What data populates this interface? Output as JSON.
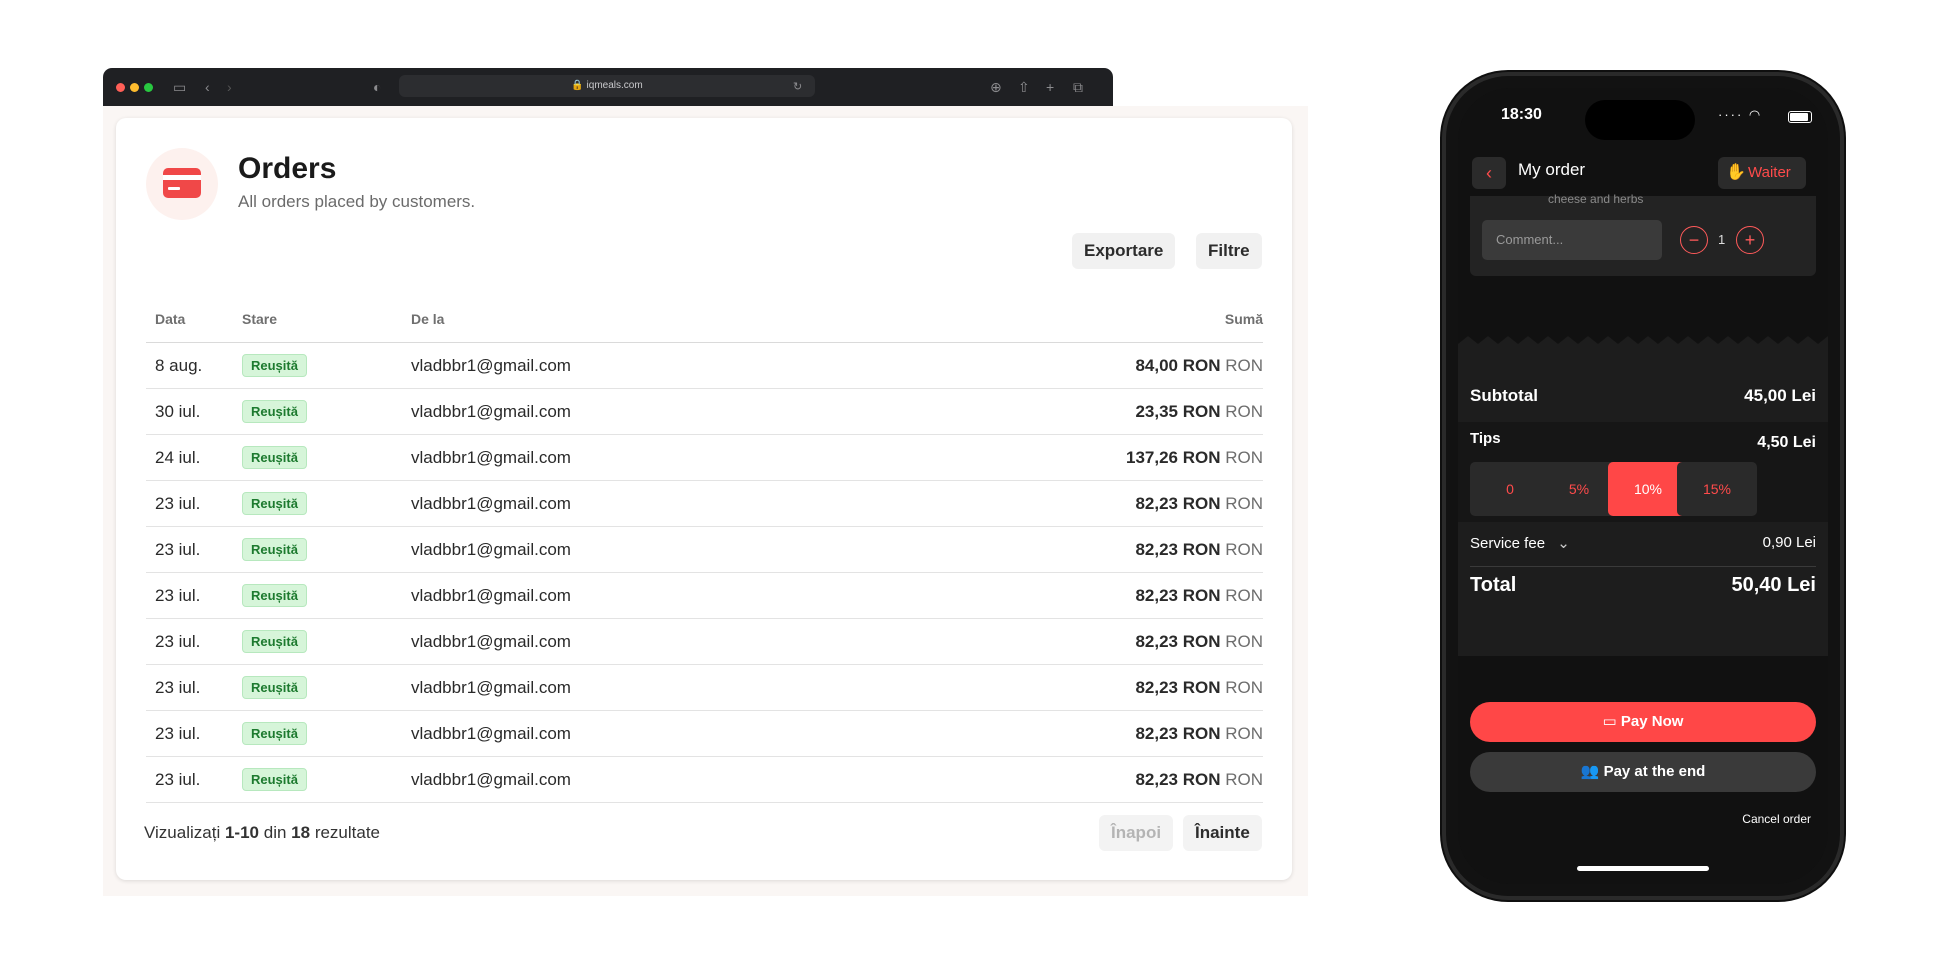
{
  "browser": {
    "url": "iqmeals.com"
  },
  "orders_page": {
    "title": "Orders",
    "subtitle": "All orders placed by customers.",
    "export_label": "Exportare",
    "filter_label": "Filtre",
    "columns": {
      "date": "Data",
      "status": "Stare",
      "from": "De la",
      "amount": "Sumă"
    },
    "rows": [
      {
        "date": "8 aug.",
        "status": "Reușită",
        "email": "vladbbr1@gmail.com",
        "amount": "84,00 RON",
        "currency": "RON"
      },
      {
        "date": "30 iul.",
        "status": "Reușită",
        "email": "vladbbr1@gmail.com",
        "amount": "23,35 RON",
        "currency": "RON"
      },
      {
        "date": "24 iul.",
        "status": "Reușită",
        "email": "vladbbr1@gmail.com",
        "amount": "137,26 RON",
        "currency": "RON"
      },
      {
        "date": "23 iul.",
        "status": "Reușită",
        "email": "vladbbr1@gmail.com",
        "amount": "82,23 RON",
        "currency": "RON"
      },
      {
        "date": "23 iul.",
        "status": "Reușită",
        "email": "vladbbr1@gmail.com",
        "amount": "82,23 RON",
        "currency": "RON"
      },
      {
        "date": "23 iul.",
        "status": "Reușită",
        "email": "vladbbr1@gmail.com",
        "amount": "82,23 RON",
        "currency": "RON"
      },
      {
        "date": "23 iul.",
        "status": "Reușită",
        "email": "vladbbr1@gmail.com",
        "amount": "82,23 RON",
        "currency": "RON"
      },
      {
        "date": "23 iul.",
        "status": "Reușită",
        "email": "vladbbr1@gmail.com",
        "amount": "82,23 RON",
        "currency": "RON"
      },
      {
        "date": "23 iul.",
        "status": "Reușită",
        "email": "vladbbr1@gmail.com",
        "amount": "82,23 RON",
        "currency": "RON"
      },
      {
        "date": "23 iul.",
        "status": "Reușită",
        "email": "vladbbr1@gmail.com",
        "amount": "82,23 RON",
        "currency": "RON"
      }
    ],
    "pagination": {
      "prefix": "Vizualizați",
      "range": "1-10",
      "middle": "din",
      "total": "18",
      "suffix": "rezultate",
      "prev_label": "Înapoi",
      "next_label": "Înainte"
    },
    "colors": {
      "accent": "#f04848",
      "success_bg": "#d6f5d9",
      "success_text": "#1d7a2f"
    }
  },
  "phone": {
    "time": "18:30",
    "screen_title": "My order",
    "waiter_label": "Waiter",
    "item_description": "cheese and herbs",
    "comment_placeholder": "Comment...",
    "quantity": "1",
    "subtotal_label": "Subtotal",
    "subtotal_value": "45,00 Lei",
    "tips_label": "Tips",
    "tips_value": "4,50 Lei",
    "tip_options": [
      {
        "label": "0",
        "active": false
      },
      {
        "label": "5%",
        "active": false
      },
      {
        "label": "10%",
        "active": true
      },
      {
        "label": "15%",
        "active": false
      }
    ],
    "service_fee_label": "Service fee",
    "service_fee_value": "0,90 Lei",
    "total_label": "Total",
    "total_value": "50,40 Lei",
    "pay_now_label": "Pay Now",
    "pay_end_label": "Pay at the end",
    "cancel_label": "Cancel order",
    "colors": {
      "accent": "#ff4747",
      "background": "#111111"
    }
  }
}
